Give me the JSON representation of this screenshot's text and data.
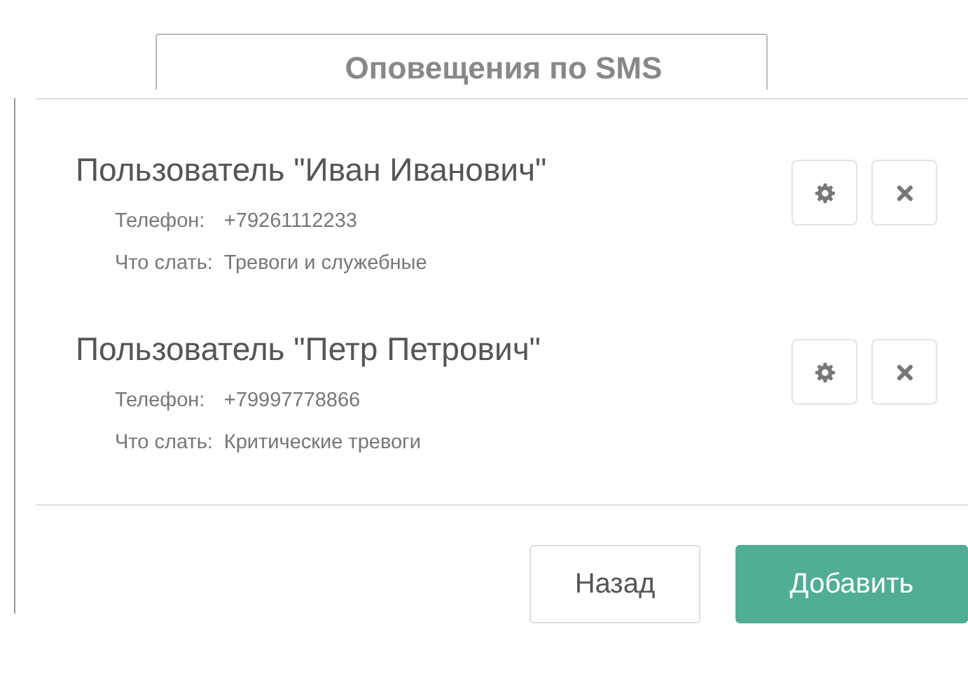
{
  "title": "Оповещения по SMS",
  "users": [
    {
      "name": "Пользователь \"Иван Иванович\"",
      "phone_label": "Телефон:",
      "phone": "+79261112233",
      "send_label": "Что слать:",
      "send": "Тревоги и служебные"
    },
    {
      "name": "Пользователь \"Петр Петрович\"",
      "phone_label": "Телефон:",
      "phone": "+79997778866",
      "send_label": "Что слать:",
      "send": "Критические тревоги"
    }
  ],
  "buttons": [
    {
      "label": "Назад",
      "kind": "default"
    },
    {
      "label": "Добавить",
      "kind": "primary"
    }
  ]
}
